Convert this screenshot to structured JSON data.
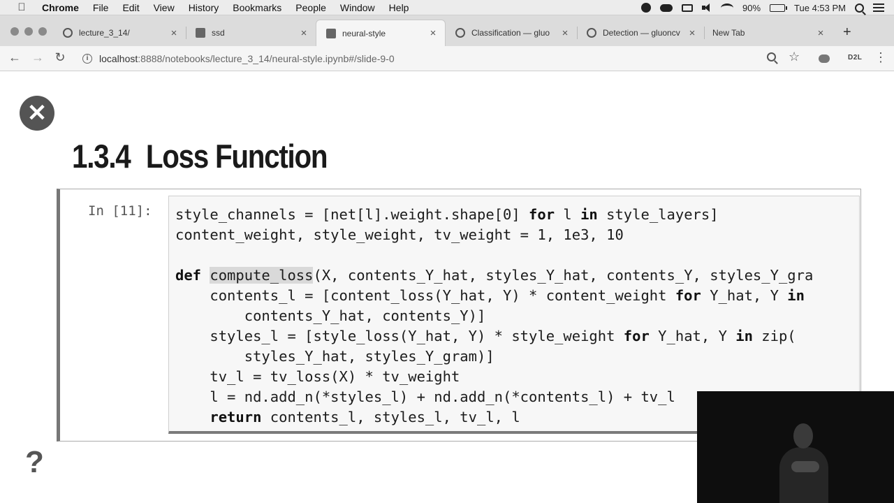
{
  "menubar": {
    "app": "Chrome",
    "items": [
      "File",
      "Edit",
      "View",
      "History",
      "Bookmarks",
      "People",
      "Window",
      "Help"
    ],
    "battery": "90%",
    "clock": "Tue 4:53 PM"
  },
  "tabs": [
    {
      "title": "lecture_3_14/",
      "icon": "globe-icon"
    },
    {
      "title": "ssd",
      "icon": "notebook-icon"
    },
    {
      "title": "neural-style",
      "icon": "notebook-icon",
      "active": true
    },
    {
      "title": "Classification — gluo",
      "icon": "gluoncv-icon"
    },
    {
      "title": "Detection — gluoncv",
      "icon": "gluoncv-icon"
    },
    {
      "title": "New Tab",
      "icon": ""
    }
  ],
  "toolbar": {
    "url_host": "localhost",
    "url_path": ":8888/notebooks/lecture_3_14/neural-style.ipynb#/slide-9-0",
    "extension_label": "D2L"
  },
  "slide": {
    "section_number": "1.3.4",
    "section_title": "Loss Function"
  },
  "cell": {
    "prompt": "In [11]:",
    "lines": [
      "style_channels = [net[l].weight.shape[0] for l in style_layers]",
      "content_weight, style_weight, tv_weight = 1, 1e3, 10",
      "",
      "def compute_loss(X, contents_Y_hat, styles_Y_hat, contents_Y, styles_Y_gra",
      "    contents_l = [content_loss(Y_hat, Y) * content_weight for Y_hat, Y in",
      "        contents_Y_hat, contents_Y)]",
      "    styles_l = [style_loss(Y_hat, Y) * style_weight for Y_hat, Y in zip(",
      "        styles_Y_hat, styles_Y_gram)]",
      "    tv_l = tv_loss(X) * tv_weight",
      "    l = nd.add_n(*styles_l) + nd.add_n(*contents_l) + tv_l",
      "    return contents_l, styles_l, tv_l, l"
    ]
  }
}
